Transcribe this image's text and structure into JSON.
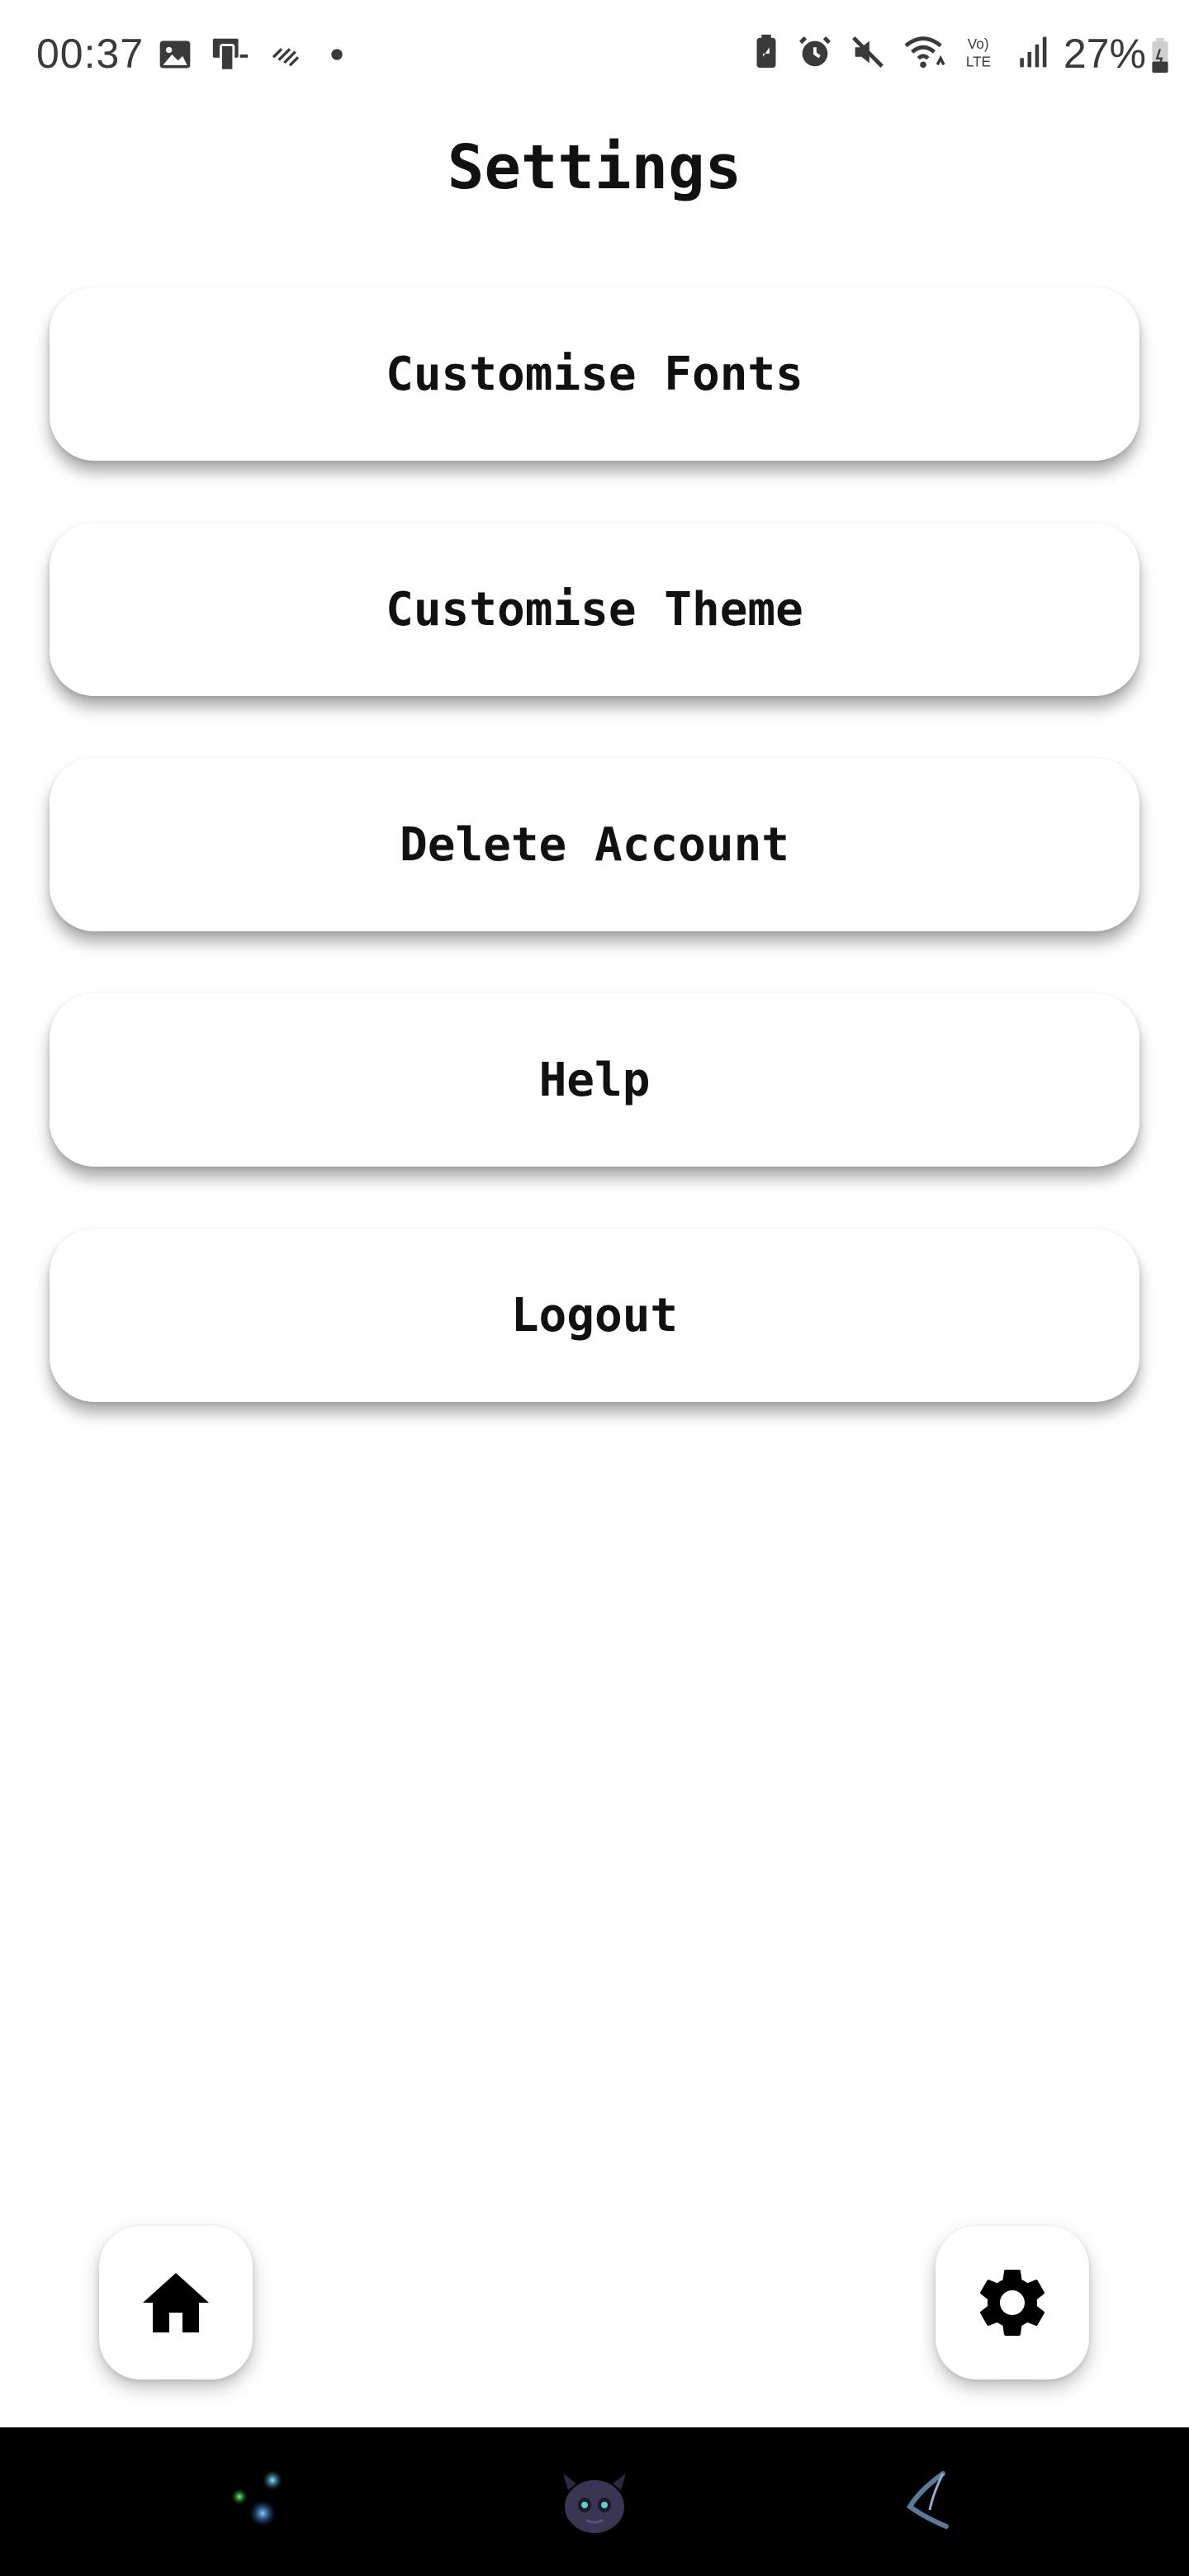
{
  "status_bar": {
    "time": "00:37",
    "battery_percent": "27%",
    "left_icons": [
      "gallery-icon",
      "phone-link-icon",
      "sync-icon",
      "dot-icon"
    ],
    "right_icons": [
      "battery-saver-icon",
      "alarm-icon",
      "mute-icon",
      "wifi-icon",
      "volte-icon",
      "signal-icon",
      "battery-icon"
    ]
  },
  "page": {
    "title": "Settings"
  },
  "settings": {
    "items": [
      {
        "label": "Customise Fonts"
      },
      {
        "label": "Customise Theme"
      },
      {
        "label": "Delete Account"
      },
      {
        "label": "Help"
      },
      {
        "label": "Logout"
      }
    ]
  },
  "bottom_nav": {
    "home_icon": "home-icon",
    "settings_icon": "gear-icon"
  },
  "system_nav": {
    "recents_icon": "recents-icon",
    "home_icon": "home-dragon-icon",
    "back_icon": "back-icon"
  },
  "colors": {
    "background": "#ffffff",
    "text": "#111111",
    "status_text": "#3a3a3a",
    "nav_bar": "#000000"
  }
}
